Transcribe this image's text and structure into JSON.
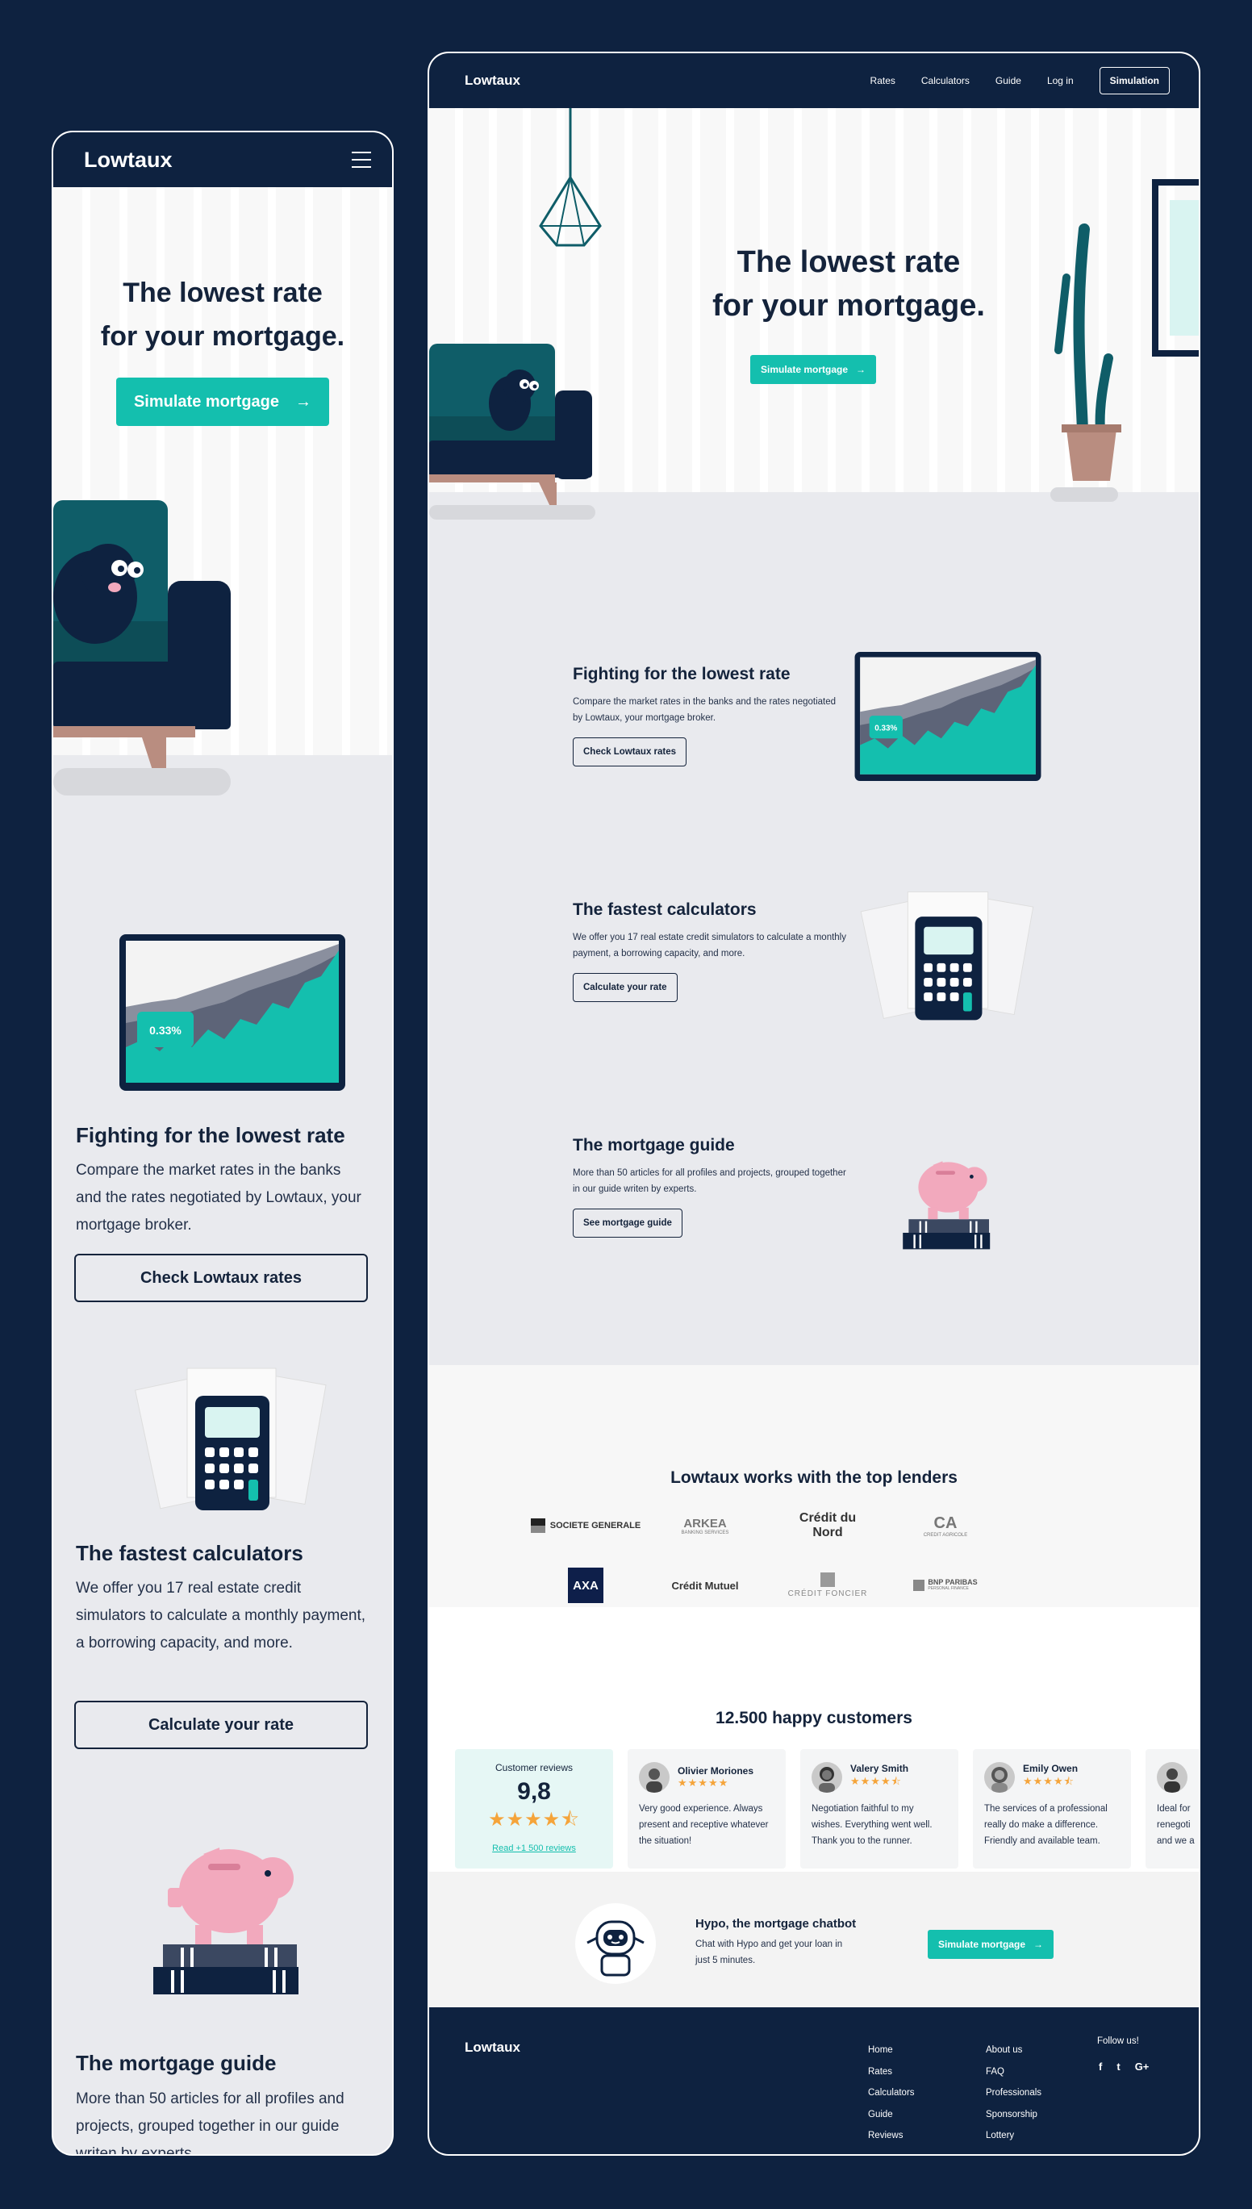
{
  "brand": "Lowtaux",
  "colors": {
    "navy": "#0e2240",
    "teal": "#14bfae",
    "pink": "#f2a9bd",
    "star": "#f5a43a"
  },
  "nav": {
    "items": [
      "Rates",
      "Calculators",
      "Guide",
      "Log in"
    ],
    "cta": "Simulation"
  },
  "hero": {
    "title_line1": "The lowest rate",
    "title_line2": "for your mortgage.",
    "cta": "Simulate mortgage"
  },
  "features": [
    {
      "title": "Fighting for the lowest rate",
      "text": "Compare the market rates in the banks and the rates negotiated by Lowtaux, your mortgage broker.",
      "button": "Check Lowtaux rates",
      "rate_badge": "0.33%"
    },
    {
      "title": "The fastest calculators",
      "text": "We offer you 17 real estate credit simulators to calculate a monthly payment, a borrowing capacity, and more.",
      "button": "Calculate your rate"
    },
    {
      "title": "The mortgage guide",
      "text": "More than 50 articles for all profiles and projects, grouped together in our guide writen by experts.",
      "button": "See mortgage guide"
    }
  ],
  "lenders": {
    "title": "Lowtaux works with the top lenders",
    "logos": [
      "SOCIETE GENERALE",
      "ARKEA",
      "Crédit du Nord",
      "CREDIT AGRICOLE",
      "AXA",
      "Crédit Mutuel",
      "CRÉDIT FONCIER",
      "BNP PARIBAS"
    ],
    "arkea_sub": "BANKING SERVICES",
    "bnp_sub": "PERSONAL FINANCE"
  },
  "reviews": {
    "title": "12.500 happy customers",
    "summary": {
      "label": "Customer reviews",
      "score": "9,8",
      "stars": "★★★★⯪",
      "link": "Read +1 500 reviews"
    },
    "items": [
      {
        "name": "Olivier Moriones",
        "stars": "★★★★★",
        "text": "Very good experience. Always present and receptive whatever the situation!"
      },
      {
        "name": "Valery Smith",
        "stars": "★★★★⯪",
        "text": "Negotiation faithful to my wishes. Everything went well. Thank you to the runner."
      },
      {
        "name": "Emily Owen",
        "stars": "★★★★⯪",
        "text": "The services of a professional really do make a difference. Friendly and available team."
      },
      {
        "name": "",
        "stars": "",
        "text": "Ideal for renegoti and we a"
      }
    ]
  },
  "chatbot": {
    "title": "Hypo, the mortgage chatbot",
    "text": "Chat with Hypo and get your loan in just 5 minutes.",
    "cta": "Simulate mortgage"
  },
  "footer": {
    "col1": [
      "Home",
      "Rates",
      "Calculators",
      "Guide",
      "Reviews"
    ],
    "col2": [
      "About us",
      "FAQ",
      "Professionals",
      "Sponsorship",
      "Lottery"
    ],
    "follow": "Follow us!",
    "social": [
      "f",
      "t",
      "G+"
    ]
  }
}
